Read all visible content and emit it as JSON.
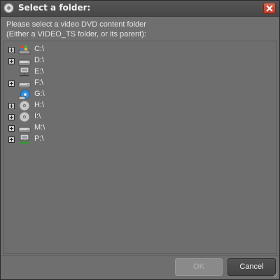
{
  "window": {
    "title": "Select a folder:"
  },
  "instructions": {
    "line1": "Please select a video DVD content folder",
    "line2": "(Either a VIDEO_TS folder, or its parent):"
  },
  "tree": {
    "items": [
      {
        "label": "C:\\",
        "icon": "os-drive-icon",
        "expandable": true
      },
      {
        "label": "D:\\",
        "icon": "hard-drive-icon",
        "expandable": true
      },
      {
        "label": "E:\\",
        "icon": "network-drive-icon",
        "expandable": false
      },
      {
        "label": "F:\\",
        "icon": "hard-drive-icon",
        "expandable": true
      },
      {
        "label": "G:\\",
        "icon": "optical-drive-icon",
        "expandable": false
      },
      {
        "label": "H:\\",
        "icon": "disc-icon",
        "expandable": true
      },
      {
        "label": "I:\\",
        "icon": "disc-icon",
        "expandable": true
      },
      {
        "label": "M:\\",
        "icon": "hard-drive-icon",
        "expandable": true
      },
      {
        "label": "P:\\",
        "icon": "network-drive-icon",
        "expandable": true
      }
    ]
  },
  "buttons": {
    "ok": "OK",
    "cancel": "Cancel"
  }
}
